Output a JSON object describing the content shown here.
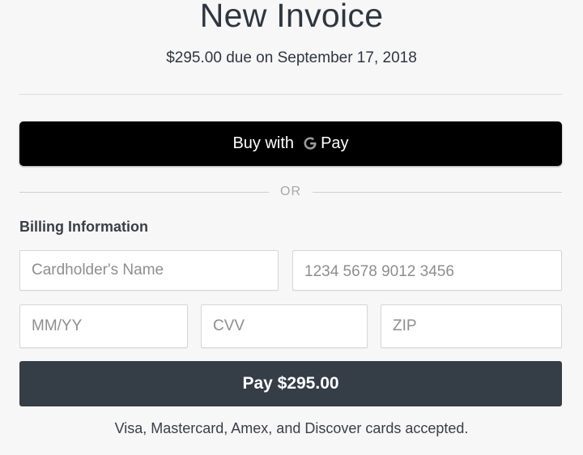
{
  "header": {
    "title": "New Invoice",
    "due_text": "$295.00 due on September 17, 2018"
  },
  "gpay": {
    "label_prefix": "Buy with",
    "pay_word": "Pay",
    "icon": "google-g-icon"
  },
  "separator": {
    "label": "OR"
  },
  "billing": {
    "section_label": "Billing Information",
    "cardholder_placeholder": "Cardholder's Name",
    "card_number_placeholder": "1234 5678 9012 3456",
    "expiry_placeholder": "MM/YY",
    "cvv_placeholder": "CVV",
    "zip_placeholder": "ZIP"
  },
  "pay_button": {
    "label": "Pay $295.00"
  },
  "footer": {
    "accepted_cards": "Visa, Mastercard, Amex, and Discover cards accepted."
  },
  "colors": {
    "background": "#f7f7f7",
    "gpay_button": "#000000",
    "pay_button": "#353d47",
    "or_text": "#a8a8a8"
  }
}
